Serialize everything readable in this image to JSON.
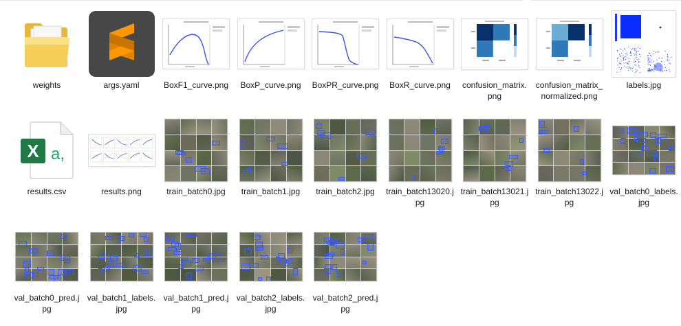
{
  "files": [
    {
      "name": "weights",
      "kind": "folder"
    },
    {
      "name": "args.yaml",
      "kind": "sublime"
    },
    {
      "name": "BoxF1_curve.png",
      "kind": "curve",
      "variant": "f1"
    },
    {
      "name": "BoxP_curve.png",
      "kind": "curve",
      "variant": "p"
    },
    {
      "name": "BoxPR_curve.png",
      "kind": "curve",
      "variant": "pr"
    },
    {
      "name": "BoxR_curve.png",
      "kind": "curve",
      "variant": "r"
    },
    {
      "name": "confusion_matrix.png",
      "kind": "matrix"
    },
    {
      "name": "confusion_matrix_normalized.png",
      "kind": "matrix-normalized"
    },
    {
      "name": "labels.jpg",
      "kind": "labels"
    },
    {
      "name": "results.csv",
      "kind": "excel"
    },
    {
      "name": "results.png",
      "kind": "results"
    },
    {
      "name": "train_batch0.jpg",
      "kind": "batch",
      "seed": 1
    },
    {
      "name": "train_batch1.jpg",
      "kind": "batch",
      "seed": 2
    },
    {
      "name": "train_batch2.jpg",
      "kind": "batch",
      "seed": 3
    },
    {
      "name": "train_batch13020.jpg",
      "kind": "batch",
      "seed": 4
    },
    {
      "name": "train_batch13021.jpg",
      "kind": "batch",
      "seed": 5
    },
    {
      "name": "train_batch13022.jpg",
      "kind": "batch",
      "seed": 6
    },
    {
      "name": "val_batch0_labels.jpg",
      "kind": "valbatch",
      "seed": 7
    },
    {
      "name": "val_batch0_pred.jpg",
      "kind": "valbatch",
      "seed": 8
    },
    {
      "name": "val_batch1_labels.jpg",
      "kind": "valbatch",
      "seed": 9
    },
    {
      "name": "val_batch1_pred.jpg",
      "kind": "valbatch",
      "seed": 10
    },
    {
      "name": "val_batch2_labels.jpg",
      "kind": "valbatch",
      "seed": 11
    },
    {
      "name": "val_batch2_pred.jpg",
      "kind": "valbatch",
      "seed": 12
    }
  ],
  "colors": {
    "folder": "#f6cf5b",
    "folder_front": "#fbe08a",
    "sublime_bg": "#474747",
    "sublime_accent": "#ff9800",
    "excel_green": "#1f7a45",
    "excel_accent": "#21a366",
    "curve_line": "#3f51e5",
    "matrix_dark": "#08306b",
    "matrix_mid": "#2f79b9",
    "matrix_light": "#c6dbef",
    "box_blue": "#3a5cff"
  }
}
